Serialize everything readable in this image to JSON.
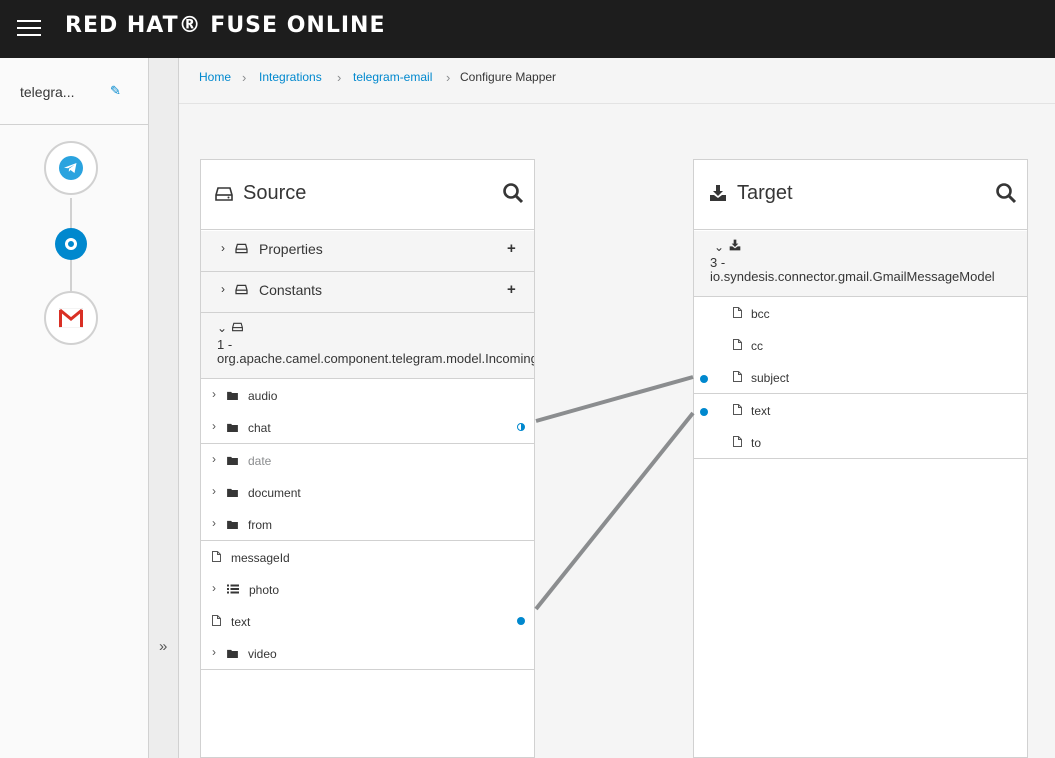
{
  "app": {
    "brand": "RED HAT® FUSE ONLINE"
  },
  "integration": {
    "name": "telegra..."
  },
  "steps": [
    {
      "icon": "telegram-icon"
    },
    {
      "icon": "data-mapper-step-icon"
    },
    {
      "icon": "gmail-icon"
    }
  ],
  "breadcrumb": {
    "home": "Home",
    "integrations": "Integrations",
    "integration": "telegram-email",
    "current": "Configure Mapper",
    "separator": "›"
  },
  "collapse": {
    "label": "»"
  },
  "source": {
    "title": "Source",
    "sections": [
      {
        "label": "Properties"
      },
      {
        "label": "Constants"
      }
    ],
    "document": {
      "index": "1 -",
      "name": "org.apache.camel.component.telegram.model.IncomingMessage"
    },
    "fields": [
      {
        "label": "audio",
        "type": "folder",
        "expandable": true
      },
      {
        "label": "chat",
        "type": "folder",
        "expandable": true,
        "mapped": "partial"
      },
      {
        "label": "date",
        "type": "folder",
        "expandable": true,
        "muted": true
      },
      {
        "label": "document",
        "type": "folder",
        "expandable": true
      },
      {
        "label": "from",
        "type": "folder",
        "expandable": true
      },
      {
        "label": "messageId",
        "type": "file",
        "expandable": false
      },
      {
        "label": "photo",
        "type": "list",
        "expandable": true
      },
      {
        "label": "text",
        "type": "file",
        "expandable": false,
        "mapped": "full"
      },
      {
        "label": "video",
        "type": "folder",
        "expandable": true
      }
    ]
  },
  "target": {
    "title": "Target",
    "document": {
      "index": "3 -",
      "name": "io.syndesis.connector.gmail.GmailMessageModel"
    },
    "fields": [
      {
        "label": "bcc",
        "mapped": false
      },
      {
        "label": "cc",
        "mapped": false
      },
      {
        "label": "subject",
        "mapped": true
      },
      {
        "label": "text",
        "mapped": true
      },
      {
        "label": "to",
        "mapped": false
      }
    ]
  },
  "colors": {
    "accent": "#0088ce",
    "topbar": "#1d1d1d",
    "connector_line": "#8b8d8f",
    "gmail_red": "#d93025",
    "telegram_blue": "#2aa3df"
  }
}
